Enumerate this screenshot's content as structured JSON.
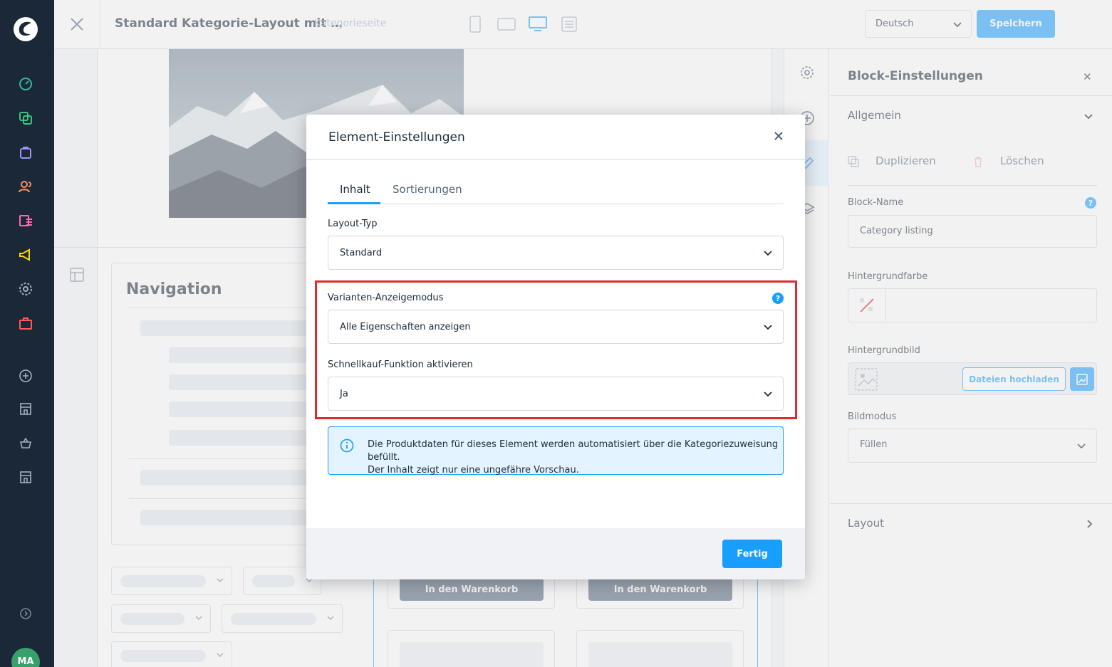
{
  "topbar": {
    "title": "Standard Kategorie-Layout mit …",
    "subtitle": "Kategorieseite",
    "language": "Deutsch",
    "save_label": "Speichern"
  },
  "sidebar": {
    "avatar_initials": "MA",
    "items": [
      "dashboard-icon",
      "catalogue-icon",
      "orders-icon",
      "customers-icon",
      "content-icon",
      "marketing-icon",
      "settings-icon",
      "extensions-icon",
      "add-sales-channel-icon",
      "storefront-icon",
      "headless-icon",
      "storefront-2-icon"
    ]
  },
  "canvas": {
    "navigation_title": "Navigation",
    "cart_button_1": "In den Warenkorb",
    "cart_button_2": "In den Warenkorb"
  },
  "panel": {
    "title": "Block-Einstellungen",
    "section_general": "Allgemein",
    "duplicate_label": "Duplizieren",
    "delete_label": "Löschen",
    "block_name_label": "Block-Name",
    "block_name_value": "Category listing",
    "bg_color_label": "Hintergrundfarbe",
    "bg_image_label": "Hintergrundbild",
    "upload_label": "Dateien hochladen",
    "image_mode_label": "Bildmodus",
    "image_mode_value": "Füllen",
    "section_layout": "Layout"
  },
  "modal": {
    "title": "Element-Einstellungen",
    "tabs": [
      {
        "label": "Inhalt",
        "active": true
      },
      {
        "label": "Sortierungen",
        "active": false
      }
    ],
    "layout_type_label": "Layout-Typ",
    "layout_type_value": "Standard",
    "variant_mode_label": "Varianten-Anzeigemodus",
    "variant_mode_value": "Alle Eigenschaften anzeigen",
    "quickbuy_label": "Schnellkauf-Funktion aktivieren",
    "quickbuy_value": "Ja",
    "info_line1": "Die Produktdaten für dieses Element werden automatisiert über die Kategoriezuweisung befüllt.",
    "info_line2": "Der Inhalt zeigt nur eine ungefähre Vorschau.",
    "done_label": "Fertig"
  },
  "colors": {
    "accent": "#189eff",
    "sidebar_bg": "#1b2837",
    "highlight": "#de2a2a",
    "info_bg": "#e3f3ff"
  }
}
